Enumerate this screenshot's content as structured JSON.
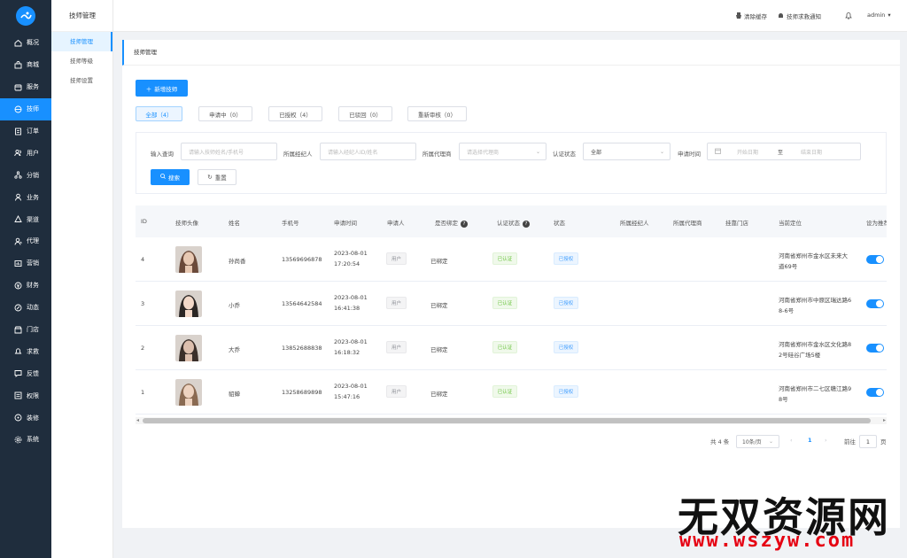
{
  "brand_color": "#1890ff",
  "sidebar": {
    "items": [
      {
        "label": "概况",
        "icon": "home-icon",
        "active": false
      },
      {
        "label": "商城",
        "icon": "store-icon",
        "active": false
      },
      {
        "label": "服务",
        "icon": "service-icon",
        "active": false
      },
      {
        "label": "技师",
        "icon": "technician-icon",
        "active": true
      },
      {
        "label": "订单",
        "icon": "order-icon",
        "active": false
      },
      {
        "label": "用户",
        "icon": "users-icon",
        "active": false
      },
      {
        "label": "分销",
        "icon": "distribution-icon",
        "active": false
      },
      {
        "label": "业务",
        "icon": "business-icon",
        "active": false
      },
      {
        "label": "渠道",
        "icon": "channel-icon",
        "active": false
      },
      {
        "label": "代理",
        "icon": "agent-icon",
        "active": false
      },
      {
        "label": "营销",
        "icon": "marketing-icon",
        "active": false
      },
      {
        "label": "财务",
        "icon": "finance-icon",
        "active": false
      },
      {
        "label": "动态",
        "icon": "dynamic-icon",
        "active": false
      },
      {
        "label": "门店",
        "icon": "shop-icon",
        "active": false
      },
      {
        "label": "求救",
        "icon": "bell-icon",
        "active": false
      },
      {
        "label": "反馈",
        "icon": "feedback-icon",
        "active": false
      },
      {
        "label": "权限",
        "icon": "permission-icon",
        "active": false
      },
      {
        "label": "装修",
        "icon": "decorate-icon",
        "active": false
      },
      {
        "label": "系统",
        "icon": "settings-icon",
        "active": false
      }
    ]
  },
  "submenu": {
    "title": "技师管理",
    "items": [
      {
        "label": "技师管理",
        "active": true
      },
      {
        "label": "技师等级",
        "active": false
      },
      {
        "label": "技师设置",
        "active": false
      }
    ]
  },
  "header": {
    "clear_cache": "清除缓存",
    "sos_notice": "技师求救通知",
    "user": "admin"
  },
  "page": {
    "title": "技师管理",
    "add_button": "新增技师",
    "tabs": [
      {
        "label": "全部（4）",
        "active": true
      },
      {
        "label": "申请中（0）",
        "active": false
      },
      {
        "label": "已授权（4）",
        "active": false
      },
      {
        "label": "已驳回（0）",
        "active": false
      },
      {
        "label": "重新审核（0）",
        "active": false
      }
    ]
  },
  "filters": {
    "query_label": "输入查询",
    "query_placeholder": "请输入技师姓名/手机号",
    "broker_label": "所属经纪人",
    "broker_placeholder": "请输入经纪人ID/姓名",
    "agent_label": "所属代理商",
    "agent_placeholder": "请选择代理商",
    "status_label": "认证状态",
    "status_value": "全部",
    "time_label": "申请时间",
    "start_placeholder": "开始日期",
    "range_sep": "至",
    "end_placeholder": "结束日期",
    "search_button": "搜索",
    "reset_button": "重置"
  },
  "table": {
    "headers": {
      "id": "ID",
      "avatar": "技师头像",
      "name": "姓名",
      "phone": "手机号",
      "apply_time": "申请时间",
      "applicant": "申请人",
      "bound": "是否绑定",
      "auth": "认证状态",
      "status": "状态",
      "broker": "所属经纪人",
      "agent": "所属代理商",
      "shop": "挂靠门店",
      "location": "当前定位",
      "recommend": "设为推荐"
    },
    "rows": [
      {
        "id": "4",
        "name": "孙尚香",
        "phone": "13569696878",
        "date": "2023-08-01",
        "time": "17:20:54",
        "applicant": "用户",
        "bound": "已绑定",
        "auth": "已认证",
        "status": "已授权",
        "loc1": "河南省郑州市金水区未来大",
        "loc2": "道69号",
        "recommend": true
      },
      {
        "id": "3",
        "name": "小乔",
        "phone": "13564642584",
        "date": "2023-08-01",
        "time": "16:41:38",
        "applicant": "用户",
        "bound": "已绑定",
        "auth": "已认证",
        "status": "已授权",
        "loc1": "河南省郑州市中原区瑞达路6",
        "loc2": "8-6号",
        "recommend": true
      },
      {
        "id": "2",
        "name": "大乔",
        "phone": "13852688838",
        "date": "2023-08-01",
        "time": "16:18:32",
        "applicant": "用户",
        "bound": "已绑定",
        "auth": "已认证",
        "status": "已授权",
        "loc1": "河南省郑州市金水区文化路8",
        "loc2": "2号硅谷广场5楼",
        "recommend": true
      },
      {
        "id": "1",
        "name": "貂蝉",
        "phone": "13258689898",
        "date": "2023-08-01",
        "time": "15:47:16",
        "applicant": "用户",
        "bound": "已绑定",
        "auth": "已认证",
        "status": "已授权",
        "loc1": "河南省郑州市二七区赣江路9",
        "loc2": "8号",
        "recommend": true
      }
    ]
  },
  "pagination": {
    "total": "共 4 条",
    "page_size": "10条/页",
    "current": "1",
    "goto_label": "前往",
    "goto_value": "1",
    "page_suffix": "页"
  },
  "watermark": {
    "line1": "无双资源网",
    "line2": "www.wszyw.com"
  }
}
